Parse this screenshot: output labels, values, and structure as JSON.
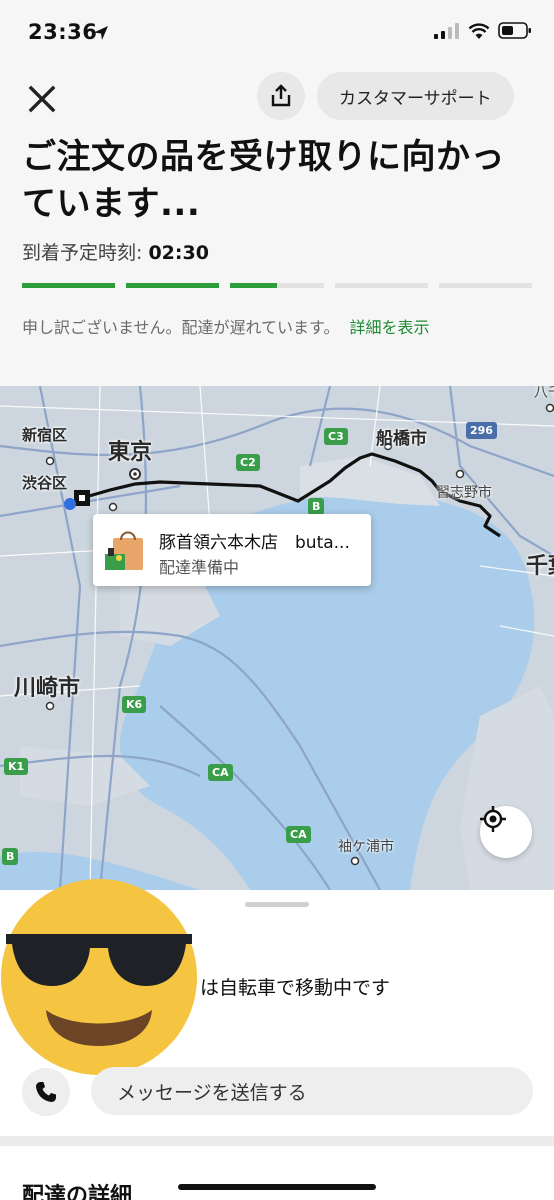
{
  "status_bar": {
    "time": "23:36"
  },
  "header": {
    "support_label": "カスタマーサポート",
    "title": "ご注文の品を受け取りに向かっています...",
    "eta_label": "到着予定時刻: ",
    "eta_value": "02:30",
    "progress_segments": [
      1.0,
      1.0,
      0.5,
      0.0,
      0.0
    ],
    "delay_message": "申し訳ございません。配達が遅れています。",
    "details_link": "詳細を表示",
    "accent_color": "#2e9e3a"
  },
  "map": {
    "labels": {
      "shinjuku": "新宿区",
      "shibuya": "渋谷区",
      "tokyo": "東京",
      "funabashi": "船橋市",
      "narashino": "習志野市",
      "kawasaki": "川崎市",
      "sodegaura": "袖ケ浦市",
      "chiba": "千葉",
      "hachi": "八千"
    },
    "shields": [
      "C3",
      "C2",
      "B",
      "296",
      "K6",
      "K1",
      "CA",
      "CA",
      "B"
    ],
    "store_card": {
      "name": "豚首領六本木店　buta...",
      "status": "配達準備中"
    }
  },
  "sheet": {
    "courier_status": "は自転車で移動中です",
    "message_placeholder": "メッセージを送信する",
    "section_title": "配達の詳細"
  }
}
